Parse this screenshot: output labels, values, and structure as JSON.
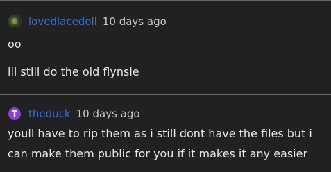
{
  "comments": [
    {
      "username": "lovedlacedoll",
      "timestamp": "10 days ago",
      "avatar": {
        "type": "image",
        "icon": "user-avatar-image"
      },
      "lines": [
        "oo",
        "ill still do the old flynsie"
      ]
    },
    {
      "username": "theduck",
      "timestamp": "10 days ago",
      "avatar": {
        "type": "letter",
        "letter": "T",
        "color": "#8e3fd0"
      },
      "lines": [
        "youll have to rip them as i still dont have the files but i",
        "can make them public for you if it makes it any easier"
      ]
    }
  ],
  "colors": {
    "background": "#212121",
    "username": "#2f6fd6",
    "divider": "#6a6a6a"
  }
}
